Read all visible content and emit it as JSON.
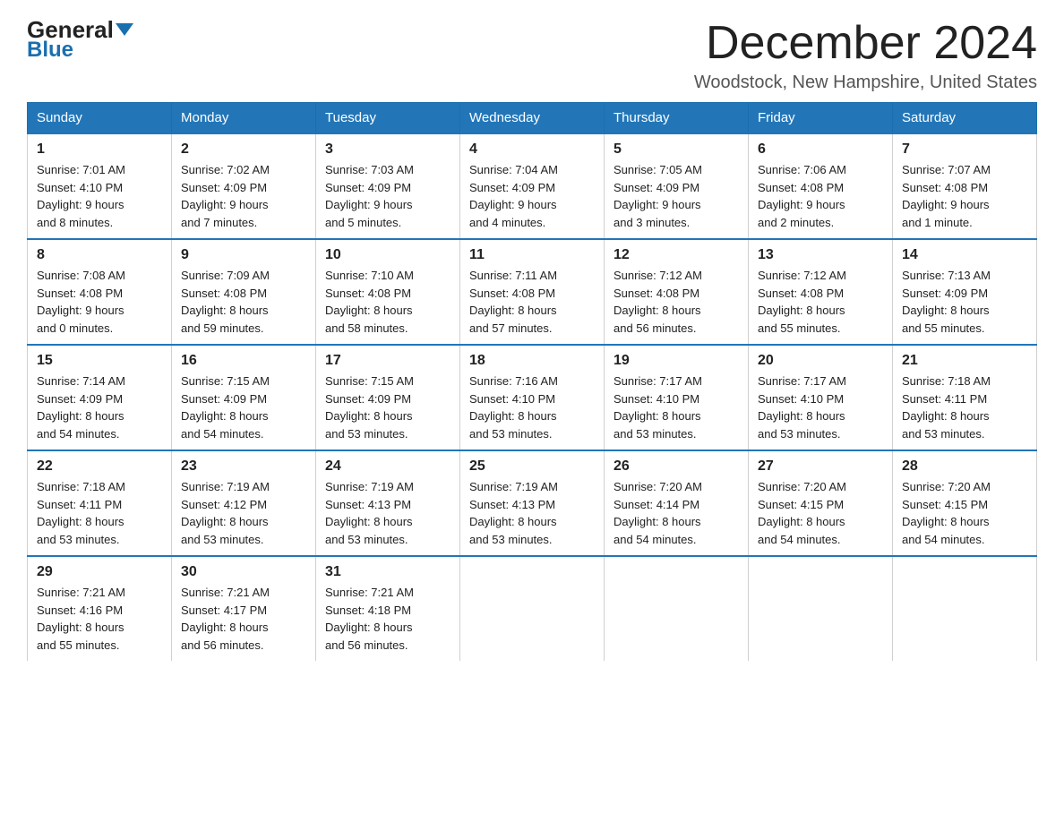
{
  "logo": {
    "general": "General",
    "blue": "Blue"
  },
  "header": {
    "title": "December 2024",
    "subtitle": "Woodstock, New Hampshire, United States"
  },
  "days_of_week": [
    "Sunday",
    "Monday",
    "Tuesday",
    "Wednesday",
    "Thursday",
    "Friday",
    "Saturday"
  ],
  "weeks": [
    [
      {
        "day": "1",
        "info": "Sunrise: 7:01 AM\nSunset: 4:10 PM\nDaylight: 9 hours\nand 8 minutes."
      },
      {
        "day": "2",
        "info": "Sunrise: 7:02 AM\nSunset: 4:09 PM\nDaylight: 9 hours\nand 7 minutes."
      },
      {
        "day": "3",
        "info": "Sunrise: 7:03 AM\nSunset: 4:09 PM\nDaylight: 9 hours\nand 5 minutes."
      },
      {
        "day": "4",
        "info": "Sunrise: 7:04 AM\nSunset: 4:09 PM\nDaylight: 9 hours\nand 4 minutes."
      },
      {
        "day": "5",
        "info": "Sunrise: 7:05 AM\nSunset: 4:09 PM\nDaylight: 9 hours\nand 3 minutes."
      },
      {
        "day": "6",
        "info": "Sunrise: 7:06 AM\nSunset: 4:08 PM\nDaylight: 9 hours\nand 2 minutes."
      },
      {
        "day": "7",
        "info": "Sunrise: 7:07 AM\nSunset: 4:08 PM\nDaylight: 9 hours\nand 1 minute."
      }
    ],
    [
      {
        "day": "8",
        "info": "Sunrise: 7:08 AM\nSunset: 4:08 PM\nDaylight: 9 hours\nand 0 minutes."
      },
      {
        "day": "9",
        "info": "Sunrise: 7:09 AM\nSunset: 4:08 PM\nDaylight: 8 hours\nand 59 minutes."
      },
      {
        "day": "10",
        "info": "Sunrise: 7:10 AM\nSunset: 4:08 PM\nDaylight: 8 hours\nand 58 minutes."
      },
      {
        "day": "11",
        "info": "Sunrise: 7:11 AM\nSunset: 4:08 PM\nDaylight: 8 hours\nand 57 minutes."
      },
      {
        "day": "12",
        "info": "Sunrise: 7:12 AM\nSunset: 4:08 PM\nDaylight: 8 hours\nand 56 minutes."
      },
      {
        "day": "13",
        "info": "Sunrise: 7:12 AM\nSunset: 4:08 PM\nDaylight: 8 hours\nand 55 minutes."
      },
      {
        "day": "14",
        "info": "Sunrise: 7:13 AM\nSunset: 4:09 PM\nDaylight: 8 hours\nand 55 minutes."
      }
    ],
    [
      {
        "day": "15",
        "info": "Sunrise: 7:14 AM\nSunset: 4:09 PM\nDaylight: 8 hours\nand 54 minutes."
      },
      {
        "day": "16",
        "info": "Sunrise: 7:15 AM\nSunset: 4:09 PM\nDaylight: 8 hours\nand 54 minutes."
      },
      {
        "day": "17",
        "info": "Sunrise: 7:15 AM\nSunset: 4:09 PM\nDaylight: 8 hours\nand 53 minutes."
      },
      {
        "day": "18",
        "info": "Sunrise: 7:16 AM\nSunset: 4:10 PM\nDaylight: 8 hours\nand 53 minutes."
      },
      {
        "day": "19",
        "info": "Sunrise: 7:17 AM\nSunset: 4:10 PM\nDaylight: 8 hours\nand 53 minutes."
      },
      {
        "day": "20",
        "info": "Sunrise: 7:17 AM\nSunset: 4:10 PM\nDaylight: 8 hours\nand 53 minutes."
      },
      {
        "day": "21",
        "info": "Sunrise: 7:18 AM\nSunset: 4:11 PM\nDaylight: 8 hours\nand 53 minutes."
      }
    ],
    [
      {
        "day": "22",
        "info": "Sunrise: 7:18 AM\nSunset: 4:11 PM\nDaylight: 8 hours\nand 53 minutes."
      },
      {
        "day": "23",
        "info": "Sunrise: 7:19 AM\nSunset: 4:12 PM\nDaylight: 8 hours\nand 53 minutes."
      },
      {
        "day": "24",
        "info": "Sunrise: 7:19 AM\nSunset: 4:13 PM\nDaylight: 8 hours\nand 53 minutes."
      },
      {
        "day": "25",
        "info": "Sunrise: 7:19 AM\nSunset: 4:13 PM\nDaylight: 8 hours\nand 53 minutes."
      },
      {
        "day": "26",
        "info": "Sunrise: 7:20 AM\nSunset: 4:14 PM\nDaylight: 8 hours\nand 54 minutes."
      },
      {
        "day": "27",
        "info": "Sunrise: 7:20 AM\nSunset: 4:15 PM\nDaylight: 8 hours\nand 54 minutes."
      },
      {
        "day": "28",
        "info": "Sunrise: 7:20 AM\nSunset: 4:15 PM\nDaylight: 8 hours\nand 54 minutes."
      }
    ],
    [
      {
        "day": "29",
        "info": "Sunrise: 7:21 AM\nSunset: 4:16 PM\nDaylight: 8 hours\nand 55 minutes."
      },
      {
        "day": "30",
        "info": "Sunrise: 7:21 AM\nSunset: 4:17 PM\nDaylight: 8 hours\nand 56 minutes."
      },
      {
        "day": "31",
        "info": "Sunrise: 7:21 AM\nSunset: 4:18 PM\nDaylight: 8 hours\nand 56 minutes."
      },
      {
        "day": "",
        "info": ""
      },
      {
        "day": "",
        "info": ""
      },
      {
        "day": "",
        "info": ""
      },
      {
        "day": "",
        "info": ""
      }
    ]
  ]
}
